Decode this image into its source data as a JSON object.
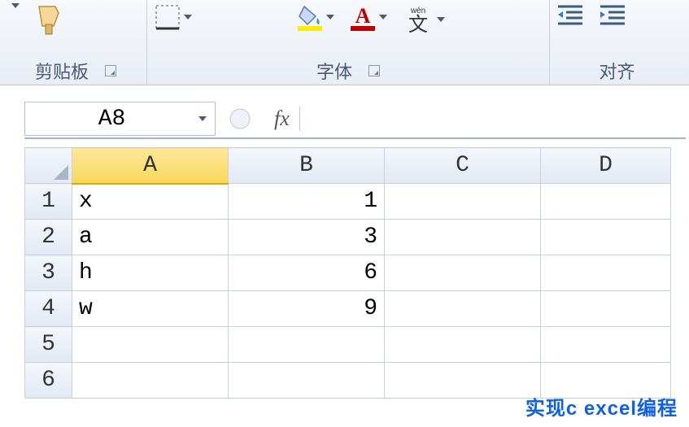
{
  "ribbon": {
    "clipboard_label": "剪贴板",
    "font_label": "字体",
    "align_label": "对齐"
  },
  "namebox": {
    "value": "A8"
  },
  "formula": {
    "fx": "fx",
    "value": ""
  },
  "columns": [
    "A",
    "B",
    "C",
    "D"
  ],
  "selected_column": "A",
  "rows": [
    {
      "n": "1",
      "A": "x",
      "B": "1",
      "C": "",
      "D": ""
    },
    {
      "n": "2",
      "A": "a",
      "B": "3",
      "C": "",
      "D": ""
    },
    {
      "n": "3",
      "A": "h",
      "B": "6",
      "C": "",
      "D": ""
    },
    {
      "n": "4",
      "A": "w",
      "B": "9",
      "C": "",
      "D": ""
    },
    {
      "n": "5",
      "A": "",
      "B": "",
      "C": "",
      "D": ""
    },
    {
      "n": "6",
      "A": "",
      "B": "",
      "C": "",
      "D": ""
    }
  ],
  "watermark": "实现c excel编程"
}
